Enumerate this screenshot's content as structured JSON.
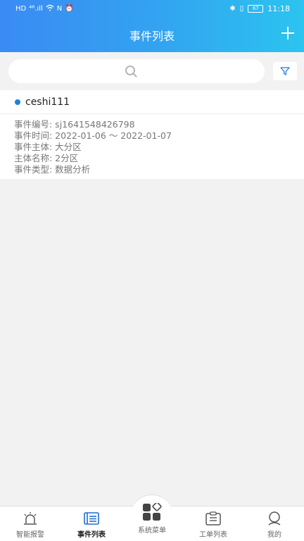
{
  "status_bar": {
    "left_icons": [
      "HD",
      "⁴⁶.ıll",
      "wifi",
      "N",
      "alarm"
    ],
    "battery": "67",
    "time": "11:18"
  },
  "header": {
    "title": "事件列表"
  },
  "search": {
    "placeholder": ""
  },
  "events": [
    {
      "name": "ceshi111",
      "fields": [
        "事件编号: sj1641548426798",
        "事件时间: 2022-01-06 ～ 2022-01-07",
        "事件主体: 大分区",
        "主体名称: 2分区",
        "事件类型: 数据分析"
      ]
    }
  ],
  "tabbar": {
    "tabs": [
      {
        "label": "智能报警",
        "icon": "alarm-bell-icon"
      },
      {
        "label": "事件列表",
        "icon": "event-list-icon",
        "active": true
      },
      {
        "label": "系统菜单",
        "icon": "grid-menu-icon"
      },
      {
        "label": "工单列表",
        "icon": "work-order-icon"
      },
      {
        "label": "我的",
        "icon": "profile-icon"
      }
    ]
  },
  "colors": {
    "accent": "#1f7fe0",
    "header_start": "#3a8bf3",
    "header_end": "#2bc4ef"
  }
}
